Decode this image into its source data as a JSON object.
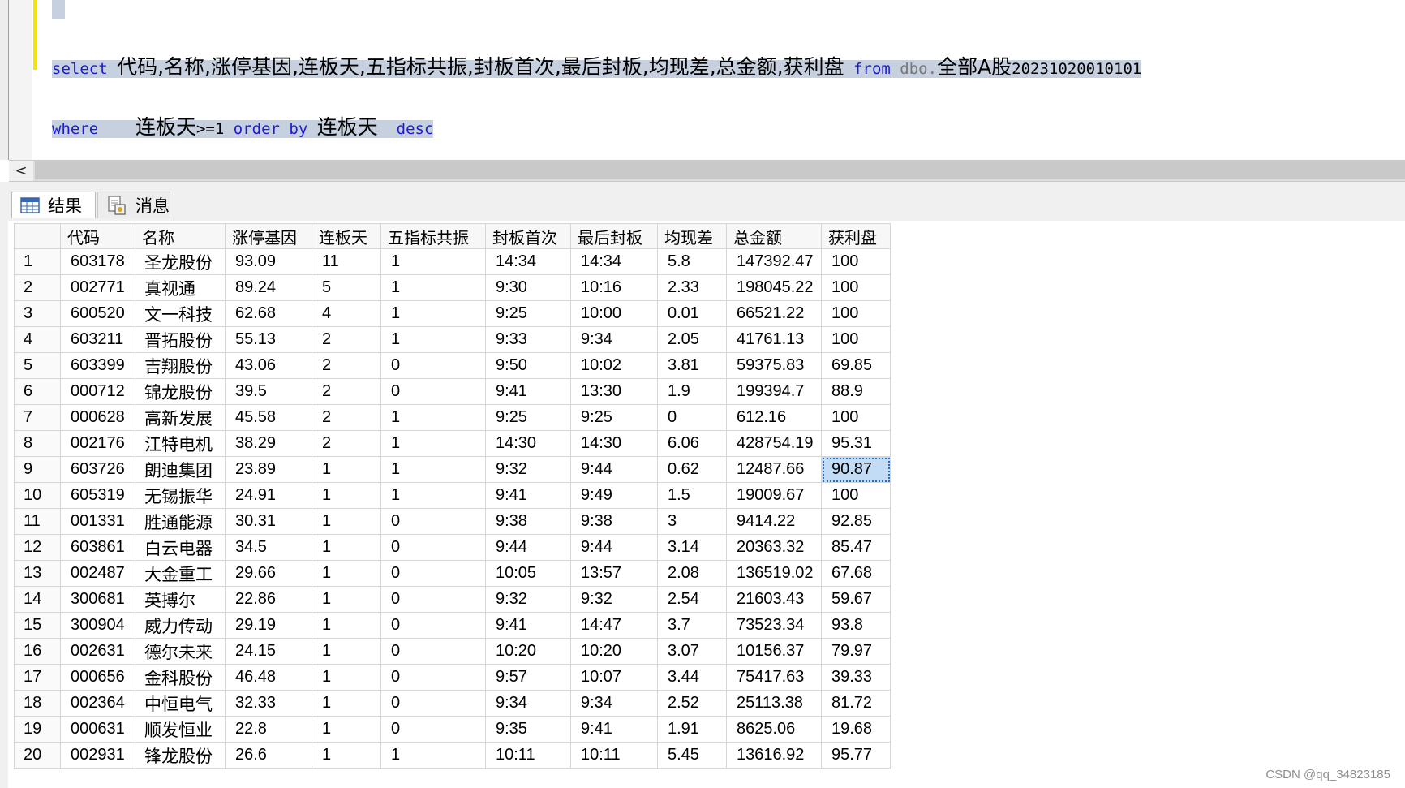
{
  "query": {
    "line1": {
      "select_kw": "select",
      "columns": "代码,名称,涨停基因,连板天,五指标共振,封板首次,最后封板,均现差,总金额,获利盘",
      "from_kw": "from",
      "table_prefix": "dbo.",
      "table_cjk": "全部A股",
      "table_suffix": "20231020010101"
    },
    "line2": {
      "where_kw": "where",
      "cond_cjk": "连板天",
      "cond_op": ">=1",
      "order_kw": "order by",
      "order_col": "连板天",
      "desc_kw": "desc"
    }
  },
  "scrollbar": {
    "left_arrow": "<"
  },
  "tabs": {
    "results_label": "结果",
    "messages_label": "消息"
  },
  "grid": {
    "columns": [
      "",
      "代码",
      "名称",
      "涨停基因",
      "连板天",
      "五指标共振",
      "封板首次",
      "最后封板",
      "均现差",
      "总金额",
      "获利盘"
    ],
    "rows": [
      [
        "1",
        "603178",
        "圣龙股份",
        "93.09",
        "11",
        "1",
        "14:34",
        "14:34",
        "5.8",
        "147392.47",
        "100"
      ],
      [
        "2",
        "002771",
        "真视通",
        "89.24",
        "5",
        "1",
        "9:30",
        "10:16",
        "2.33",
        "198045.22",
        "100"
      ],
      [
        "3",
        "600520",
        "文一科技",
        "62.68",
        "4",
        "1",
        "9:25",
        "10:00",
        "0.01",
        "66521.22",
        "100"
      ],
      [
        "4",
        "603211",
        "晋拓股份",
        "55.13",
        "2",
        "1",
        "9:33",
        "9:34",
        "2.05",
        "41761.13",
        "100"
      ],
      [
        "5",
        "603399",
        "吉翔股份",
        "43.06",
        "2",
        "0",
        "9:50",
        "10:02",
        "3.81",
        "59375.83",
        "69.85"
      ],
      [
        "6",
        "000712",
        "锦龙股份",
        "39.5",
        "2",
        "0",
        "9:41",
        "13:30",
        "1.9",
        "199394.7",
        "88.9"
      ],
      [
        "7",
        "000628",
        "高新发展",
        "45.58",
        "2",
        "1",
        "9:25",
        "9:25",
        "0",
        "612.16",
        "100"
      ],
      [
        "8",
        "002176",
        "江特电机",
        "38.29",
        "2",
        "1",
        "14:30",
        "14:30",
        "6.06",
        "428754.19",
        "95.31"
      ],
      [
        "9",
        "603726",
        "朗迪集团",
        "23.89",
        "1",
        "1",
        "9:32",
        "9:44",
        "0.62",
        "12487.66",
        "90.87"
      ],
      [
        "10",
        "605319",
        "无锡振华",
        "24.91",
        "1",
        "1",
        "9:41",
        "9:49",
        "1.5",
        "19009.67",
        "100"
      ],
      [
        "11",
        "001331",
        "胜通能源",
        "30.31",
        "1",
        "0",
        "9:38",
        "9:38",
        "3",
        "9414.22",
        "92.85"
      ],
      [
        "12",
        "603861",
        "白云电器",
        "34.5",
        "1",
        "0",
        "9:44",
        "9:44",
        "3.14",
        "20363.32",
        "85.47"
      ],
      [
        "13",
        "002487",
        "大金重工",
        "29.66",
        "1",
        "0",
        "10:05",
        "13:57",
        "2.08",
        "136519.02",
        "67.68"
      ],
      [
        "14",
        "300681",
        "英搏尔",
        "22.86",
        "1",
        "0",
        "9:32",
        "9:32",
        "2.54",
        "21603.43",
        "59.67"
      ],
      [
        "15",
        "300904",
        "威力传动",
        "29.19",
        "1",
        "0",
        "9:41",
        "14:47",
        "3.7",
        "73523.34",
        "93.8"
      ],
      [
        "16",
        "002631",
        "德尔未来",
        "24.15",
        "1",
        "0",
        "10:20",
        "10:20",
        "3.07",
        "10156.37",
        "79.97"
      ],
      [
        "17",
        "000656",
        "金科股份",
        "46.48",
        "1",
        "0",
        "9:57",
        "10:07",
        "3.44",
        "75417.63",
        "39.33"
      ],
      [
        "18",
        "002364",
        "中恒电气",
        "32.33",
        "1",
        "0",
        "9:34",
        "9:34",
        "2.52",
        "25113.38",
        "81.72"
      ],
      [
        "19",
        "000631",
        "顺发恒业",
        "22.8",
        "1",
        "0",
        "9:35",
        "9:41",
        "1.91",
        "8625.06",
        "19.68"
      ],
      [
        "20",
        "002931",
        "锋龙股份",
        "26.6",
        "1",
        "1",
        "10:11",
        "10:11",
        "5.45",
        "13616.92",
        "95.77"
      ]
    ]
  },
  "watermark": "CSDN @qq_34823185",
  "colors": {
    "selection": "#c7d0de",
    "keyword": "#1b1bd6",
    "change_bar": "#f2e600",
    "selected_cell": "#c3dcf5"
  }
}
